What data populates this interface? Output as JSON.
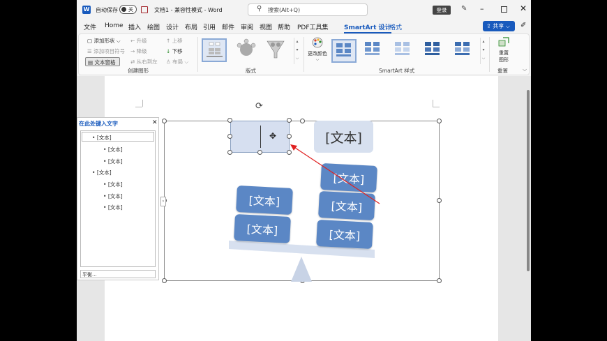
{
  "titlebar": {
    "autosave_label": "自动保存",
    "autosave_state": "关",
    "doc_title": "文档1 - 兼容性模式 - Word",
    "search_placeholder": "搜索(Alt+Q)",
    "login_label": "登录"
  },
  "menu": {
    "items": [
      "文件",
      "Home",
      "插入",
      "绘图",
      "设计",
      "布局",
      "引用",
      "邮件",
      "审阅",
      "视图",
      "帮助",
      "PDF工具集",
      "SmartArt 设计",
      "格式"
    ],
    "active": "SmartArt 设计",
    "share_label": "共享"
  },
  "ribbon": {
    "create_graphic": {
      "add_shape": "添加形状",
      "add_bullet": "添加项目符号",
      "text_pane": "文本窗格",
      "promote": "升级",
      "demote": "降级",
      "right_to_left": "从右到左",
      "move_up": "上移",
      "move_down": "下移",
      "layout": "布局",
      "group_label": "创建图形"
    },
    "layouts": {
      "group_label": "版式"
    },
    "styles": {
      "change_colors": "更改颜色",
      "group_label": "SmartArt 样式"
    },
    "reset": {
      "reset_graphic_1": "重置",
      "reset_graphic_2": "图形",
      "group_label": "重置"
    }
  },
  "text_pane": {
    "title": "在此处键入文字",
    "items": [
      {
        "level": 1,
        "text": "[文本]"
      },
      {
        "level": 2,
        "text": "[文本]"
      },
      {
        "level": 2,
        "text": "[文本]"
      },
      {
        "level": 1,
        "text": "[文本]"
      },
      {
        "level": 2,
        "text": "[文本]"
      },
      {
        "level": 2,
        "text": "[文本]"
      },
      {
        "level": 2,
        "text": "[文本]"
      }
    ],
    "footer": "平衡..."
  },
  "smartart": {
    "header_text": "[文本]",
    "left_boxes": [
      "[文本]",
      "[文本]"
    ],
    "right_boxes": [
      "[文本]",
      "[文本]",
      "[文本]"
    ]
  },
  "colors": {
    "accent": "#185abd",
    "shape": "#5b87c5",
    "selected_shape": "#d6dff0",
    "header": "#d7e0ef"
  }
}
